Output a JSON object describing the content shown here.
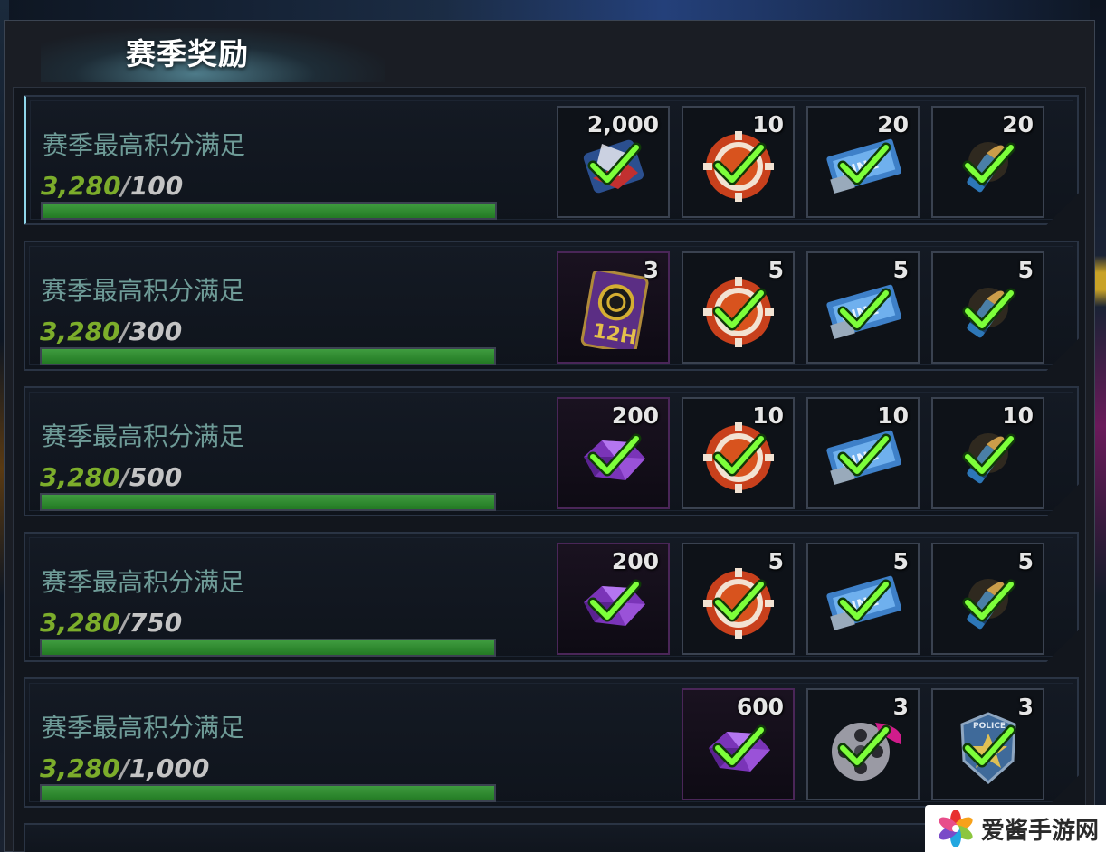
{
  "panel": {
    "title": "赛季奖励"
  },
  "rows": [
    {
      "condition": "赛季最高积分满足",
      "current": "3,280",
      "required": "100",
      "progress": 1.0,
      "rewards": [
        {
          "icon": "gift-pack-icon",
          "qty": "2,000",
          "claimed": true
        },
        {
          "icon": "casino-chip-icon",
          "qty": "10",
          "claimed": true
        },
        {
          "icon": "cinema-ticket-icon",
          "qty": "20",
          "claimed": true
        },
        {
          "icon": "bullet-icon",
          "qty": "20",
          "claimed": true
        }
      ]
    },
    {
      "condition": "赛季最高积分满足",
      "current": "3,280",
      "required": "300",
      "progress": 1.0,
      "rewards": [
        {
          "icon": "12h-boost-card-icon",
          "qty": "3",
          "claimed": false,
          "label": "12H"
        },
        {
          "icon": "casino-chip-icon",
          "qty": "5",
          "claimed": true
        },
        {
          "icon": "cinema-ticket-icon",
          "qty": "5",
          "claimed": true
        },
        {
          "icon": "bullet-icon",
          "qty": "5",
          "claimed": true
        }
      ]
    },
    {
      "condition": "赛季最高积分满足",
      "current": "3,280",
      "required": "500",
      "progress": 1.0,
      "rewards": [
        {
          "icon": "purple-gem-icon",
          "qty": "200",
          "claimed": true
        },
        {
          "icon": "casino-chip-icon",
          "qty": "10",
          "claimed": true
        },
        {
          "icon": "cinema-ticket-icon",
          "qty": "10",
          "claimed": true
        },
        {
          "icon": "bullet-icon",
          "qty": "10",
          "claimed": true
        }
      ]
    },
    {
      "condition": "赛季最高积分满足",
      "current": "3,280",
      "required": "750",
      "progress": 1.0,
      "rewards": [
        {
          "icon": "purple-gem-icon",
          "qty": "200",
          "claimed": true
        },
        {
          "icon": "casino-chip-icon",
          "qty": "5",
          "claimed": true
        },
        {
          "icon": "cinema-ticket-icon",
          "qty": "5",
          "claimed": true
        },
        {
          "icon": "bullet-icon",
          "qty": "5",
          "claimed": true
        }
      ]
    },
    {
      "condition": "赛季最高积分满足",
      "current": "3,280",
      "required": "1,000",
      "progress": 1.0,
      "rewards": [
        {
          "icon": "purple-gem-icon",
          "qty": "600",
          "claimed": true
        },
        {
          "icon": "film-reel-icon",
          "qty": "3",
          "claimed": true
        },
        {
          "icon": "police-badge-icon",
          "qty": "3",
          "claimed": true
        }
      ]
    }
  ],
  "watermark": {
    "text": "爱酱手游网"
  },
  "colors": {
    "progress_current": "#7cad2b",
    "condition_text": "#6e9b97",
    "check_green": "#7dff3a",
    "bar_fill": "#2e8b2e"
  }
}
